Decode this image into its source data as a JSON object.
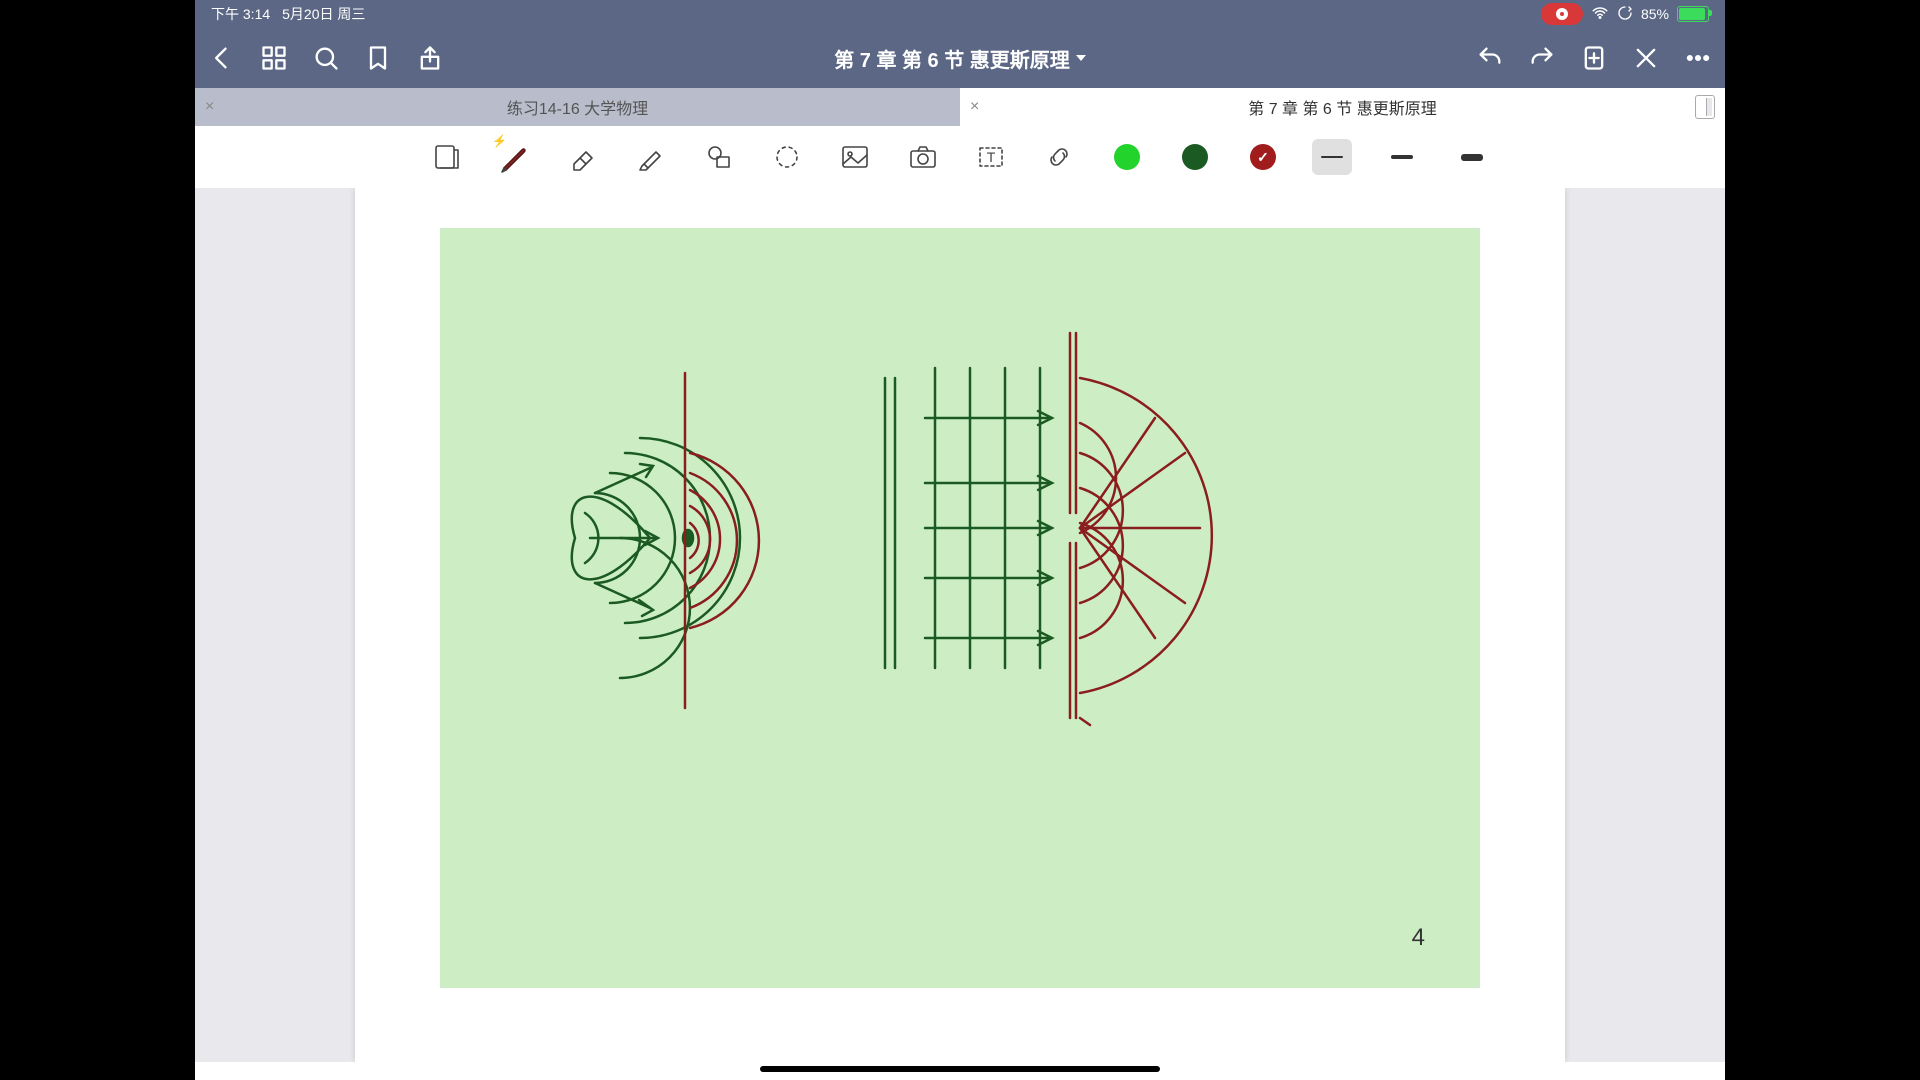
{
  "status": {
    "time": "下午 3:14",
    "date": "5月20日 周三",
    "battery_pct": "85%"
  },
  "nav": {
    "title": "第 7 章 第 6 节 惠更斯原理"
  },
  "tabs": [
    {
      "label": "练习14-16 大学物理",
      "active": false
    },
    {
      "label": "第 7 章 第 6 节 惠更斯原理",
      "active": true
    }
  ],
  "toolbar": {
    "tools": [
      {
        "name": "read-mode-icon"
      },
      {
        "name": "pen-tool",
        "selected": true
      },
      {
        "name": "eraser-tool"
      },
      {
        "name": "highlighter-tool"
      },
      {
        "name": "shape-tool"
      },
      {
        "name": "lasso-tool"
      },
      {
        "name": "image-tool"
      },
      {
        "name": "camera-tool"
      },
      {
        "name": "text-tool"
      },
      {
        "name": "link-tool"
      }
    ],
    "colors": [
      {
        "name": "bright-green",
        "hex": "#21d32a",
        "selected": false
      },
      {
        "name": "dark-green",
        "hex": "#1b5a22",
        "selected": false
      },
      {
        "name": "dark-red",
        "hex": "#a11d1d",
        "selected": true
      }
    ],
    "strokes": [
      {
        "name": "thin",
        "h": 2,
        "selected": true
      },
      {
        "name": "medium",
        "h": 4,
        "selected": false
      },
      {
        "name": "thick",
        "h": 7,
        "selected": false
      }
    ]
  },
  "canvas": {
    "page_number": "4"
  }
}
